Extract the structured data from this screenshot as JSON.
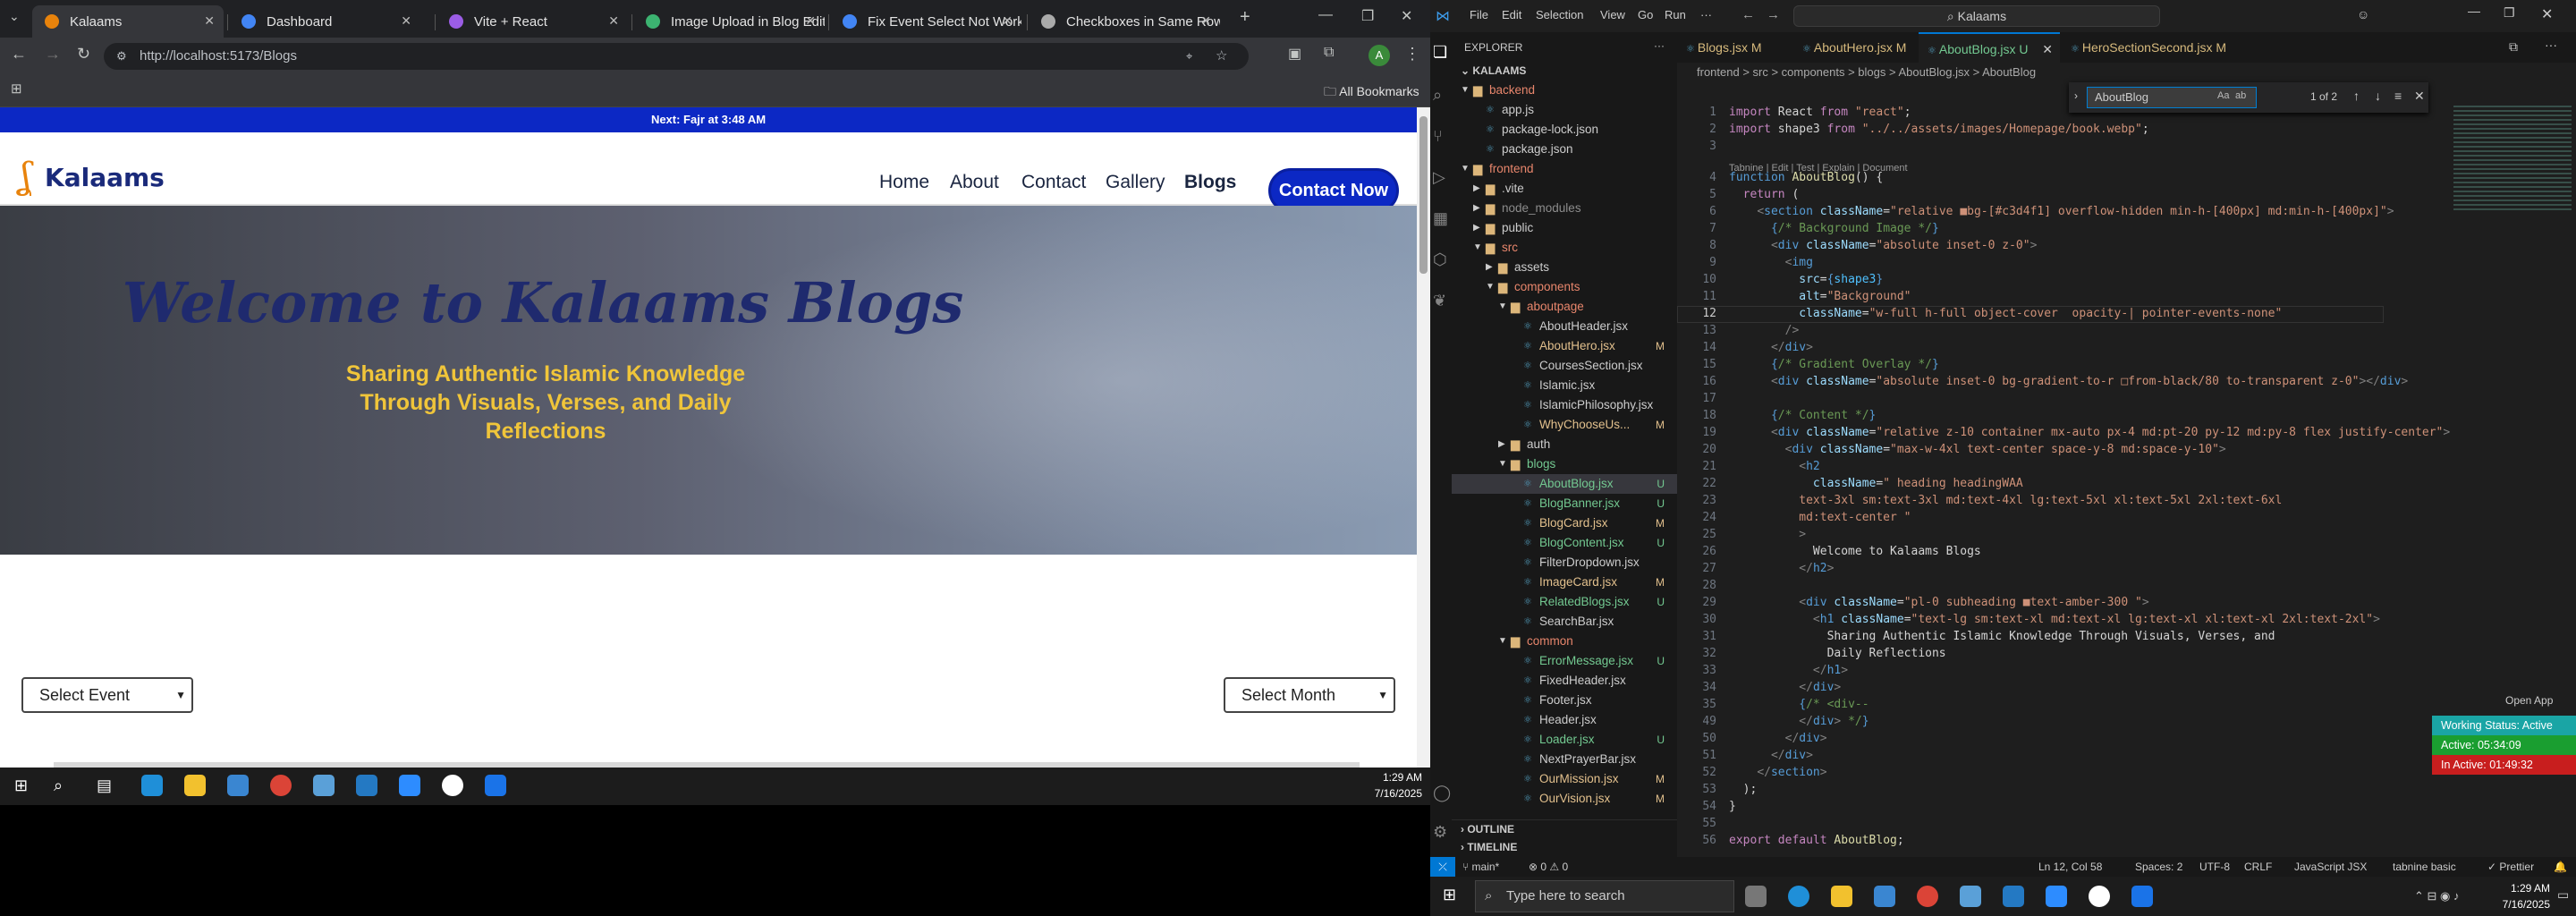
{
  "browser": {
    "tabs": [
      {
        "title": "Kalaams",
        "color": "#e8830c"
      },
      {
        "title": "Dashboard",
        "color": "#4285f4"
      },
      {
        "title": "Vite + React",
        "color": "#9b5de5"
      },
      {
        "title": "Image Upload in Blog Editor",
        "color": "#3cb371"
      },
      {
        "title": "Fix Event Select Not Working",
        "color": "#4285f4"
      },
      {
        "title": "Checkboxes in Same Row",
        "color": "#aaaaaa"
      }
    ],
    "url": "http://localhost:5173/Blogs",
    "all_bookmarks": "All Bookmarks"
  },
  "site": {
    "prayer_bar": "Next: Fajr at 3:48 AM",
    "logo": "Kalaams",
    "nav": [
      "Home",
      "About",
      "Contact",
      "Gallery",
      "Blogs"
    ],
    "cta": "Contact Now",
    "hero_title": "Welcome to Kalaams Blogs",
    "hero_subtitle": "Sharing Authentic Islamic Knowledge Through Visuals, Verses, and Daily Reflections",
    "select_event": "Select Event",
    "select_month": "Select Month"
  },
  "taskbar_left": {
    "time": "1:29 AM",
    "date": "7/16/2025"
  },
  "vscode": {
    "search_title": "Kalaams",
    "menu": [
      "File",
      "Edit",
      "Selection",
      "View",
      "Go",
      "Run",
      "···"
    ],
    "explorer_label": "EXPLORER",
    "workspace": "KALAAMS",
    "tree": [
      {
        "depth": 0,
        "name": "backend",
        "type": "folder",
        "open": true,
        "status": "",
        "color": "#e8866c"
      },
      {
        "depth": 1,
        "name": "app.js",
        "type": "file",
        "status": "",
        "color": "#cccccc"
      },
      {
        "depth": 1,
        "name": "package-lock.json",
        "type": "file",
        "status": "",
        "color": "#cccccc"
      },
      {
        "depth": 1,
        "name": "package.json",
        "type": "file",
        "status": "",
        "color": "#cccccc"
      },
      {
        "depth": 0,
        "name": "frontend",
        "type": "folder",
        "open": true,
        "status": "",
        "color": "#e8866c"
      },
      {
        "depth": 1,
        "name": ".vite",
        "type": "folder",
        "open": false,
        "status": "",
        "color": "#cccccc"
      },
      {
        "depth": 1,
        "name": "node_modules",
        "type": "folder",
        "open": false,
        "status": "",
        "color": "#8c8c8c"
      },
      {
        "depth": 1,
        "name": "public",
        "type": "folder",
        "open": false,
        "status": "",
        "color": "#cccccc"
      },
      {
        "depth": 1,
        "name": "src",
        "type": "folder",
        "open": true,
        "status": "",
        "color": "#e8866c"
      },
      {
        "depth": 2,
        "name": "assets",
        "type": "folder",
        "open": false,
        "status": "",
        "color": "#cccccc"
      },
      {
        "depth": 2,
        "name": "components",
        "type": "folder",
        "open": true,
        "status": "",
        "color": "#e8866c"
      },
      {
        "depth": 3,
        "name": "aboutpage",
        "type": "folder",
        "open": true,
        "status": "",
        "color": "#e8866c"
      },
      {
        "depth": 4,
        "name": "AboutHeader.jsx",
        "type": "file",
        "status": "",
        "color": "#cccccc"
      },
      {
        "depth": 4,
        "name": "AboutHero.jsx",
        "type": "file",
        "status": "M",
        "color": "#e2c08d"
      },
      {
        "depth": 4,
        "name": "CoursesSection.jsx",
        "type": "file",
        "status": "",
        "color": "#cccccc"
      },
      {
        "depth": 4,
        "name": "Islamic.jsx",
        "type": "file",
        "status": "",
        "color": "#cccccc"
      },
      {
        "depth": 4,
        "name": "IslamicPhilosophy.jsx",
        "type": "file",
        "status": "",
        "color": "#cccccc"
      },
      {
        "depth": 4,
        "name": "WhyChooseUs...",
        "type": "file",
        "status": "M",
        "color": "#e2c08d"
      },
      {
        "depth": 3,
        "name": "auth",
        "type": "folder",
        "open": false,
        "status": "",
        "color": "#cccccc"
      },
      {
        "depth": 3,
        "name": "blogs",
        "type": "folder",
        "open": true,
        "status": "",
        "color": "#73c991"
      },
      {
        "depth": 4,
        "name": "AboutBlog.jsx",
        "type": "file",
        "status": "U",
        "color": "#73c991",
        "selected": true
      },
      {
        "depth": 4,
        "name": "BlogBanner.jsx",
        "type": "file",
        "status": "U",
        "color": "#73c991"
      },
      {
        "depth": 4,
        "name": "BlogCard.jsx",
        "type": "file",
        "status": "M",
        "color": "#e2c08d"
      },
      {
        "depth": 4,
        "name": "BlogContent.jsx",
        "type": "file",
        "status": "U",
        "color": "#73c991"
      },
      {
        "depth": 4,
        "name": "FilterDropdown.jsx",
        "type": "file",
        "status": "",
        "color": "#cccccc"
      },
      {
        "depth": 4,
        "name": "ImageCard.jsx",
        "type": "file",
        "status": "M",
        "color": "#e2c08d"
      },
      {
        "depth": 4,
        "name": "RelatedBlogs.jsx",
        "type": "file",
        "status": "U",
        "color": "#73c991"
      },
      {
        "depth": 4,
        "name": "SearchBar.jsx",
        "type": "file",
        "status": "",
        "color": "#cccccc"
      },
      {
        "depth": 3,
        "name": "common",
        "type": "folder",
        "open": true,
        "status": "",
        "color": "#e8866c"
      },
      {
        "depth": 4,
        "name": "ErrorMessage.jsx",
        "type": "file",
        "status": "U",
        "color": "#73c991"
      },
      {
        "depth": 4,
        "name": "FixedHeader.jsx",
        "type": "file",
        "status": "",
        "color": "#cccccc"
      },
      {
        "depth": 4,
        "name": "Footer.jsx",
        "type": "file",
        "status": "",
        "color": "#cccccc"
      },
      {
        "depth": 4,
        "name": "Header.jsx",
        "type": "file",
        "status": "",
        "color": "#cccccc"
      },
      {
        "depth": 4,
        "name": "Loader.jsx",
        "type": "file",
        "status": "U",
        "color": "#73c991"
      },
      {
        "depth": 4,
        "name": "NextPrayerBar.jsx",
        "type": "file",
        "status": "",
        "color": "#cccccc"
      },
      {
        "depth": 4,
        "name": "OurMission.jsx",
        "type": "file",
        "status": "M",
        "color": "#e2c08d"
      },
      {
        "depth": 4,
        "name": "OurVision.jsx",
        "type": "file",
        "status": "M",
        "color": "#e2c08d"
      }
    ],
    "outline": "OUTLINE",
    "timeline": "TIMELINE",
    "editor_tabs": [
      {
        "label": "Blogs.jsx",
        "status": "M",
        "active": false
      },
      {
        "label": "AboutHero.jsx",
        "status": "M",
        "active": false
      },
      {
        "label": "AboutBlog.jsx",
        "status": "U",
        "active": true
      },
      {
        "label": "HeroSectionSecond.jsx",
        "status": "M",
        "active": false
      }
    ],
    "breadcrumb": "frontend > src > components > blogs > AboutBlog.jsx > AboutBlog",
    "find_query": "AboutBlog",
    "find_result": "1 of 2",
    "codelens": "Tabnine | Edit | Test | Explain | Document",
    "code_lines": [
      {
        "n": "1",
        "t": "<span class='t-kw'>import</span> React <span class='t-kw'>from</span> <span class='t-str'>\"react\"</span>;"
      },
      {
        "n": "2",
        "t": "<span class='t-kw'>import</span> shape3 <span class='t-kw'>from</span> <span class='t-str'>\"../../assets/images/Homepage/book.webp\"</span>;"
      },
      {
        "n": "3",
        "t": ""
      },
      {
        "n": "4",
        "t": "<span class='t-tag'>function</span> <span class='t-fn'>AboutBlog</span>() {"
      },
      {
        "n": "5",
        "t": "  <span class='t-kw'>return</span> ("
      },
      {
        "n": "6",
        "t": "    <span class='t-p'>&lt;</span><span class='t-tag'>section</span> <span class='t-attr'>className</span>=<span class='t-str'>\"relative ■bg-[#c3d4f1] overflow-hidden min-h-[400px] md:min-h-[400px]\"</span><span class='t-p'>&gt;</span>"
      },
      {
        "n": "7",
        "t": "      <span class='t-tag'>{</span><span class='t-cmt'>/* Background Image */</span><span class='t-tag'>}</span>"
      },
      {
        "n": "8",
        "t": "      <span class='t-p'>&lt;</span><span class='t-tag'>div</span> <span class='t-attr'>className</span>=<span class='t-str'>\"absolute inset-0 z-0\"</span><span class='t-p'>&gt;</span>"
      },
      {
        "n": "9",
        "t": "        <span class='t-p'>&lt;</span><span class='t-tag'>img</span>"
      },
      {
        "n": "10",
        "t": "          <span class='t-attr'>src</span>=<span class='t-tag'>{</span><span class='t-var'>shape3</span><span class='t-tag'>}</span>"
      },
      {
        "n": "11",
        "t": "          <span class='t-attr'>alt</span>=<span class='t-str'>\"Background\"</span>"
      },
      {
        "n": "12",
        "t": "          <span class='t-attr'>className</span>=<span class='t-str'>\"w-full h-full object-cover  opacity-| pointer-events-none\"</span>"
      },
      {
        "n": "13",
        "t": "        <span class='t-p'>/&gt;</span>"
      },
      {
        "n": "14",
        "t": "      <span class='t-p'>&lt;/</span><span class='t-tag'>div</span><span class='t-p'>&gt;</span>"
      },
      {
        "n": "15",
        "t": "      <span class='t-tag'>{</span><span class='t-cmt'>/* Gradient Overlay */</span><span class='t-tag'>}</span>"
      },
      {
        "n": "16",
        "t": "      <span class='t-p'>&lt;</span><span class='t-tag'>div</span> <span class='t-attr'>className</span>=<span class='t-str'>\"absolute inset-0 bg-gradient-to-r □from-black/80 to-transparent z-0\"</span><span class='t-p'>&gt;&lt;/</span><span class='t-tag'>div</span><span class='t-p'>&gt;</span>"
      },
      {
        "n": "17",
        "t": ""
      },
      {
        "n": "18",
        "t": "      <span class='t-tag'>{</span><span class='t-cmt'>/* Content */</span><span class='t-tag'>}</span>"
      },
      {
        "n": "19",
        "t": "      <span class='t-p'>&lt;</span><span class='t-tag'>div</span> <span class='t-attr'>className</span>=<span class='t-str'>\"relative z-10 container mx-auto px-4 md:pt-20 py-12 md:py-8 flex justify-center\"</span><span class='t-p'>&gt;</span>"
      },
      {
        "n": "20",
        "t": "        <span class='t-p'>&lt;</span><span class='t-tag'>div</span> <span class='t-attr'>className</span>=<span class='t-str'>\"max-w-4xl text-center space-y-8 md:space-y-10\"</span><span class='t-p'>&gt;</span>"
      },
      {
        "n": "21",
        "t": "          <span class='t-p'>&lt;</span><span class='t-tag'>h2</span>"
      },
      {
        "n": "22",
        "t": "            <span class='t-attr'>className</span>=<span class='t-str'>\" heading headingWAA</span>"
      },
      {
        "n": "23",
        "t": "<span class='t-str'>          text-3xl sm:text-3xl md:text-4xl lg:text-5xl xl:text-5xl 2xl:text-6xl</span>"
      },
      {
        "n": "24",
        "t": "<span class='t-str'>          md:text-center \"</span>"
      },
      {
        "n": "25",
        "t": "          <span class='t-p'>&gt;</span>"
      },
      {
        "n": "26",
        "t": "            Welcome to Kalaams Blogs"
      },
      {
        "n": "27",
        "t": "          <span class='t-p'>&lt;/</span><span class='t-tag'>h2</span><span class='t-p'>&gt;</span>"
      },
      {
        "n": "28",
        "t": ""
      },
      {
        "n": "29",
        "t": "          <span class='t-p'>&lt;</span><span class='t-tag'>div</span> <span class='t-attr'>className</span>=<span class='t-str'>\"pl-0 subheading ■text-amber-300 \"</span><span class='t-p'>&gt;</span>"
      },
      {
        "n": "30",
        "t": "            <span class='t-p'>&lt;</span><span class='t-tag'>h1</span> <span class='t-attr'>className</span>=<span class='t-str'>\"text-lg sm:text-xl md:text-xl lg:text-xl xl:text-xl 2xl:text-2xl\"</span><span class='t-p'>&gt;</span>"
      },
      {
        "n": "31",
        "t": "              Sharing Authentic Islamic Knowledge Through Visuals, Verses, and"
      },
      {
        "n": "32",
        "t": "              Daily Reflections"
      },
      {
        "n": "33",
        "t": "            <span class='t-p'>&lt;/</span><span class='t-tag'>h1</span><span class='t-p'>&gt;</span>"
      },
      {
        "n": "34",
        "t": "          <span class='t-p'>&lt;/</span><span class='t-tag'>div</span><span class='t-p'>&gt;</span>"
      },
      {
        "n": "35",
        "t": "          <span class='t-tag'>{</span><span class='t-cmt'>/* &lt;div--</span>"
      },
      {
        "n": "49",
        "t": "          <span class='t-p'>&lt;/</span><span class='t-tag'>div</span><span class='t-p'>&gt;</span> <span class='t-cmt'>*/</span><span class='t-tag'>}</span>"
      },
      {
        "n": "50",
        "t": "        <span class='t-p'>&lt;/</span><span class='t-tag'>div</span><span class='t-p'>&gt;</span>"
      },
      {
        "n": "51",
        "t": "      <span class='t-p'>&lt;/</span><span class='t-tag'>div</span><span class='t-p'>&gt;</span>"
      },
      {
        "n": "52",
        "t": "    <span class='t-p'>&lt;/</span><span class='t-tag'>section</span><span class='t-p'>&gt;</span>"
      },
      {
        "n": "53",
        "t": "  );"
      },
      {
        "n": "54",
        "t": "}"
      },
      {
        "n": "55",
        "t": ""
      },
      {
        "n": "56",
        "t": "<span class='t-kw'>export</span> <span class='t-kw'>default</span> <span class='t-fn'>AboutBlog</span>;"
      }
    ],
    "status": {
      "branch": "main*",
      "errors": "⊗ 0 ⚠ 0",
      "position": "Ln 12, Col 58",
      "spaces": "Spaces: 2",
      "encoding": "UTF-8",
      "eol": "CRLF",
      "language": "JavaScript JSX",
      "tabnine": "tabnine basic",
      "prettier": "✓ Prettier"
    },
    "open_app": "Open App",
    "badges": [
      {
        "label": "Working Status: Active",
        "color": "#1aa5a5"
      },
      {
        "label": "Active: 05:34:09",
        "color": "#1a9e30"
      },
      {
        "label": "In Active: 01:49:32",
        "color": "#c81e1e"
      }
    ]
  },
  "taskbar_right": {
    "search_placeholder": "Type here to search",
    "time": "1:29 AM",
    "date": "7/16/2025"
  }
}
